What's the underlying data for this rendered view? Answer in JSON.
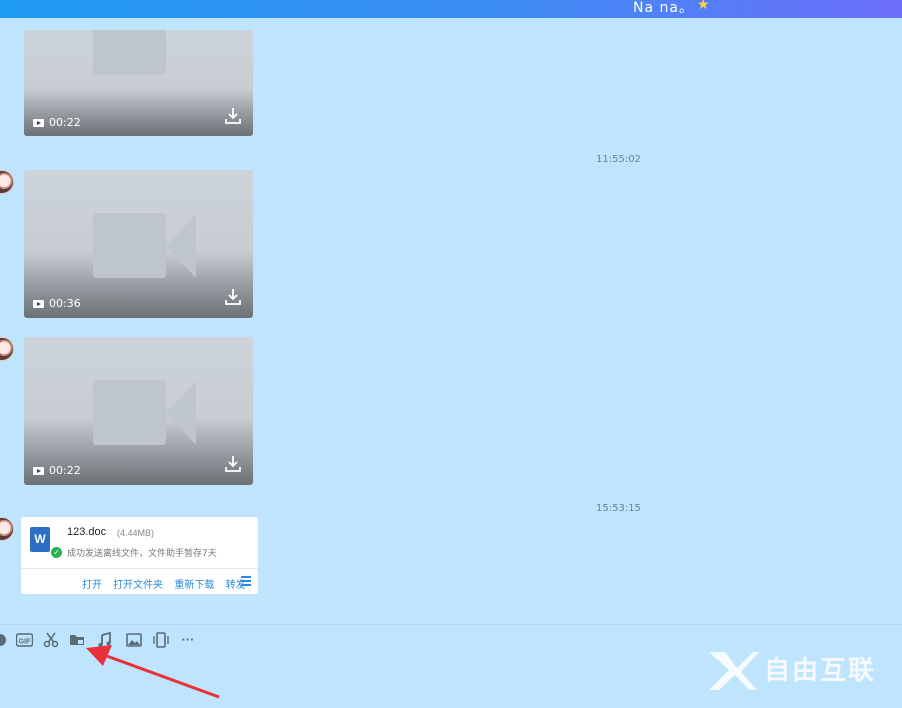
{
  "header": {
    "contact_name": "Na  na。",
    "star_icon": "★"
  },
  "messages": {
    "timestamps": [
      "11:55:02",
      "15:53:15"
    ],
    "videos": [
      {
        "duration": "00:22"
      },
      {
        "duration": "00:36"
      },
      {
        "duration": "00:22"
      }
    ],
    "file": {
      "name": "123.doc",
      "size": "(4.44MB)",
      "type_icon": "W",
      "status": "成功发送离线文件，文件助手暂存7天",
      "actions": [
        "打开",
        "打开文件夹",
        "重新下载",
        "转发"
      ]
    }
  },
  "toolbar": {
    "icons": [
      "emoji-icon",
      "gif-icon",
      "scissors-icon",
      "folder-icon",
      "music-icon",
      "image-icon",
      "shake-icon",
      "more-icon"
    ],
    "gif_label": "GIF",
    "more_label": "···"
  },
  "watermark": {
    "text": "自由互联"
  },
  "colors": {
    "background": "#bfe4fd",
    "accent": "#2a8be0",
    "arrow": "#e8323a"
  }
}
